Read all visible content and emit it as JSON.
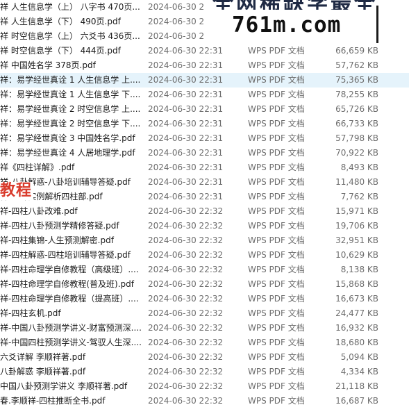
{
  "watermark": {
    "top_text": "全网稀缺学最全",
    "domain": "761m.com",
    "tag": "教程"
  },
  "files": [
    {
      "name": "祥 人生信息学（上） 八字书 470页....",
      "date": "2024-06-30 2",
      "type": "",
      "size": ""
    },
    {
      "name": "祥 人生信息学（下） 490页.pdf",
      "date": "2024-06-30 2",
      "type": "",
      "size": ""
    },
    {
      "name": "祥 时空信息学（上） 六爻书 436页....",
      "date": "2024-06-30 2",
      "type": "",
      "size": ""
    },
    {
      "name": "祥 时空信息学（下） 444页.pdf",
      "date": "2024-06-30 22:31",
      "type": "WPS PDF 文档",
      "size": "66,659 KB"
    },
    {
      "name": "祥 中国姓名学 378页.pdf",
      "date": "2024-06-30 22:31",
      "type": "WPS PDF 文档",
      "size": "57,762 KB"
    },
    {
      "name": "祥：易学经世真诠 1 人生信息学 上....",
      "date": "2024-06-30 22:31",
      "type": "WPS PDF 文档",
      "size": "75,365 KB"
    },
    {
      "name": "祥：易学经世真诠 1 人生信息学 下....",
      "date": "2024-06-30 22:31",
      "type": "WPS PDF 文档",
      "size": "78,255 KB"
    },
    {
      "name": "祥：易学经世真诠 2 时空信息学 上....",
      "date": "2024-06-30 22:31",
      "type": "WPS PDF 文档",
      "size": "65,726 KB"
    },
    {
      "name": "祥：易学经世真诠 2 时空信息学 下....",
      "date": "2024-06-30 22:31",
      "type": "WPS PDF 文档",
      "size": "66,733 KB"
    },
    {
      "name": "祥：易学经世真诠 3 中国姓名学.pdf",
      "date": "2024-06-30 22:31",
      "type": "WPS PDF 文档",
      "size": "57,798 KB"
    },
    {
      "name": "祥：易学经世真诠 4 人居地理学.pdf",
      "date": "2024-06-30 22:31",
      "type": "WPS PDF 文档",
      "size": "70,922 KB"
    },
    {
      "name": "祥《四柱详解》.pdf",
      "date": "2024-06-30 22:31",
      "type": "WPS PDF 文档",
      "size": "8,493 KB"
    },
    {
      "name": "祥-八卦解惑-八卦培训辅导答疑.pdf",
      "date": "2024-06-30 22:31",
      "type": "WPS PDF 文档",
      "size": "11,480 KB"
    },
    {
      "name": "祥-八卦实例解析四柱部.pdf",
      "date": "2024-06-30 22:31",
      "type": "WPS PDF 文档",
      "size": "7,762 KB"
    },
    {
      "name": "祥-四柱八卦改难.pdf",
      "date": "2024-06-30 22:32",
      "type": "WPS PDF 文档",
      "size": "15,971 KB"
    },
    {
      "name": "祥-四柱八卦预测学精修答疑.pdf",
      "date": "2024-06-30 22:32",
      "type": "WPS PDF 文档",
      "size": "19,706 KB"
    },
    {
      "name": "祥-四柱集锦-人生预测解密.pdf",
      "date": "2024-06-30 22:32",
      "type": "WPS PDF 文档",
      "size": "32,951 KB"
    },
    {
      "name": "祥-四柱解惑-四柱培训辅导答疑.pdf",
      "date": "2024-06-30 22:32",
      "type": "WPS PDF 文档",
      "size": "10,629 KB"
    },
    {
      "name": "祥-四柱命理学自修教程（高级班）....",
      "date": "2024-06-30 22:32",
      "type": "WPS PDF 文档",
      "size": "8,138 KB"
    },
    {
      "name": "祥-四柱命理学自修教程(普及班).pdf",
      "date": "2024-06-30 22:32",
      "type": "WPS PDF 文档",
      "size": "15,868 KB"
    },
    {
      "name": "祥-四柱命理学自修教程（提高班）....",
      "date": "2024-06-30 22:32",
      "type": "WPS PDF 文档",
      "size": "16,673 KB"
    },
    {
      "name": "祥-四柱玄机.pdf",
      "date": "2024-06-30 22:32",
      "type": "WPS PDF 文档",
      "size": "24,477 KB"
    },
    {
      "name": "祥-中国八卦预测学讲义-财富预测深....",
      "date": "2024-06-30 22:32",
      "type": "WPS PDF 文档",
      "size": "16,932 KB"
    },
    {
      "name": "祥-中国四柱预测学讲义-驾驭人生深....",
      "date": "2024-06-30 22:32",
      "type": "WPS PDF 文档",
      "size": "18,680 KB"
    },
    {
      "name": "六爻详解  李顺祥著.pdf",
      "date": "2024-06-30 22:32",
      "type": "WPS PDF 文档",
      "size": "5,094 KB"
    },
    {
      "name": " 八卦解惑 李顺祥著.pdf",
      "date": "2024-06-30 22:32",
      "type": "WPS PDF 文档",
      "size": "4,334 KB"
    },
    {
      "name": " 中国八卦预测学讲义 李顺祥著.pdf",
      "date": "2024-06-30 22:32",
      "type": "WPS PDF 文档",
      "size": "21,118 KB"
    },
    {
      "name": "春.李顺祥-四柱推断全书.pdf",
      "date": "2024-06-30 22:32",
      "type": "WPS PDF 文档",
      "size": "16,687 KB"
    }
  ]
}
